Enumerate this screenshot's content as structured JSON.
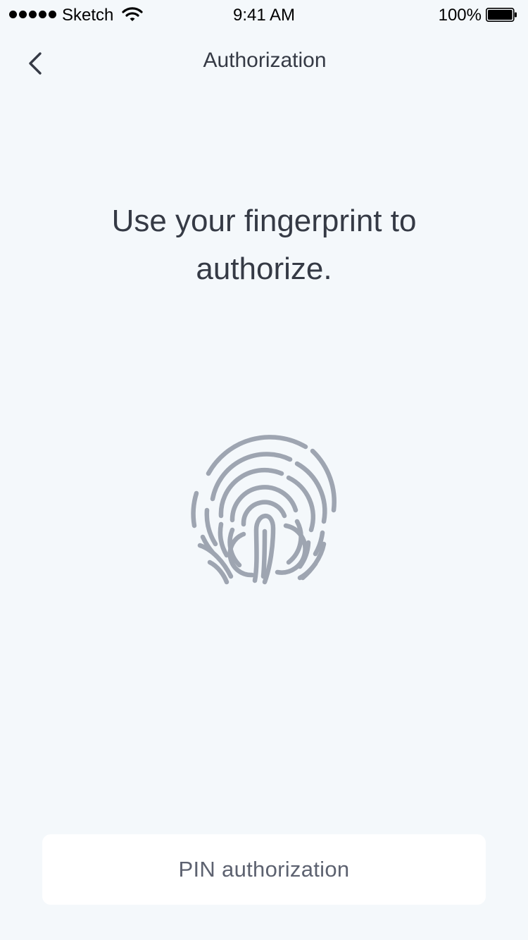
{
  "status_bar": {
    "carrier": "Sketch",
    "time": "9:41 AM",
    "battery_percent": "100%",
    "icons": [
      "signal-dots-icon",
      "wifi-icon",
      "battery-icon"
    ]
  },
  "nav": {
    "back_icon": "chevron-left-icon",
    "title": "Authorization"
  },
  "main": {
    "heading": "Use your fingerprint to authorize.",
    "icon": "fingerprint-icon"
  },
  "footer": {
    "pin_button_label": "PIN authorization"
  },
  "colors": {
    "background": "#f4f8fb",
    "text": "#353a45",
    "fingerprint": "#9ea5b1",
    "button_background": "#ffffff",
    "button_text": "#5d6270"
  }
}
